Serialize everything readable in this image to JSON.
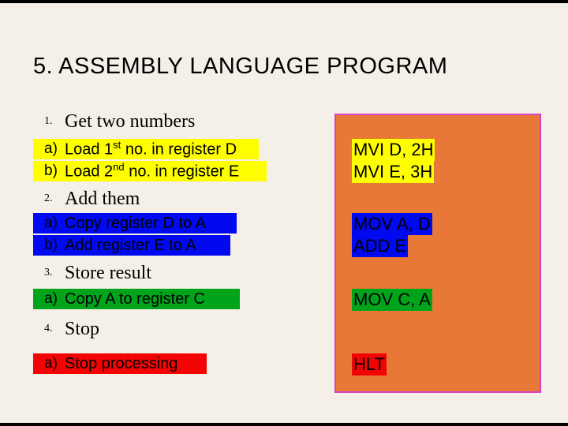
{
  "title": "5. ASSEMBLY LANGUAGE PROGRAM",
  "steps": {
    "s1": {
      "marker": "1.",
      "text": "Get two numbers"
    },
    "s1a": {
      "marker": "a)",
      "text_html": "Load 1<sup>st</sup> no. in register D"
    },
    "s1b": {
      "marker": "b)",
      "text_html": "Load 2<sup>nd</sup> no. in register E"
    },
    "s2": {
      "marker": "2.",
      "text": "Add them"
    },
    "s2a": {
      "marker": "a)",
      "text": "Copy register D to A"
    },
    "s2b": {
      "marker": "b)",
      "text": "Add register E to A"
    },
    "s3": {
      "marker": "3.",
      "text": "Store result"
    },
    "s3a": {
      "marker": "a)",
      "text": "Copy A to register C"
    },
    "s4": {
      "marker": "4.",
      "text": "Stop"
    },
    "s4a": {
      "marker": "a)",
      "text": "Stop processing"
    }
  },
  "asm": {
    "a1": "MVI D, 2H",
    "a2": "MVI E, 3H",
    "a3": "MOV A, D",
    "a4": "ADD E",
    "a5": "MOV C, A",
    "a6": "HLT"
  }
}
